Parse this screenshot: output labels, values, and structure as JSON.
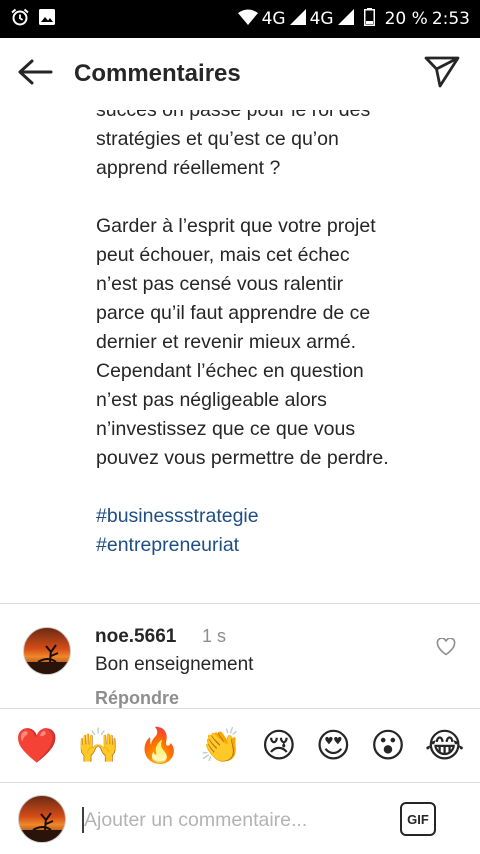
{
  "status_bar": {
    "network_1": "4G",
    "network_2": "4G",
    "battery": "20 %",
    "time": "2:53",
    "icons": [
      "alarm-icon",
      "image-icon",
      "wifi-hotspot-icon",
      "signal-icon",
      "battery-icon"
    ]
  },
  "header": {
    "title": "Commentaires",
    "back_icon": "arrow-left-icon",
    "share_icon": "send-icon"
  },
  "caption": {
    "paragraph_1": "succès on passe pour le roi des\nstratégies et qu’est ce qu’on\napprend réellement ?",
    "paragraph_2": "Garder à l’esprit que votre projet\npeut échouer, mais cet échec\nn’est pas censé vous ralentir\nparce qu’il faut apprendre de ce\ndernier et revenir mieux armé.\nCependant l’échec en question\nn’est pas négligeable alors\nn’investissez que ce que vous\npouvez vous permettre de perdre.",
    "hashtags": [
      "#businessstrategie",
      "#entrepreneuriat"
    ],
    "link_color": "#1e4e84"
  },
  "comment": {
    "username": "noe.5661",
    "time": "1 s",
    "text": "Bon enseignement",
    "reply_label": "Répondre",
    "like_icon": "heart-outline-icon"
  },
  "emoji_bar": {
    "emojis": [
      "❤️",
      "🙌",
      "🔥",
      "👏",
      "😢",
      "😍",
      "😮",
      "😂"
    ]
  },
  "input_bar": {
    "placeholder": "Ajouter un commentaire...",
    "gif_label": "GIF"
  }
}
